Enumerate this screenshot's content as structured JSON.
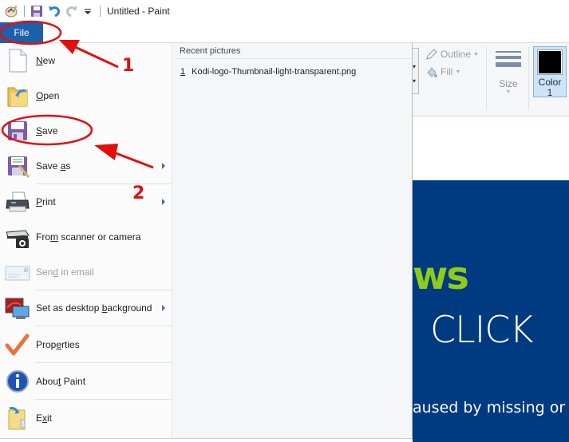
{
  "window": {
    "title": "Untitled - Paint"
  },
  "quick_access": {
    "icons": [
      "paint-app-icon",
      "save-icon",
      "undo-icon",
      "redo-icon",
      "customize-qa-icon"
    ]
  },
  "tabs": {
    "file_label": "File"
  },
  "file_menu": {
    "items": [
      {
        "label_pre": "",
        "label_ul": "N",
        "label_post": "ew",
        "icon": "new-file-icon",
        "has_submenu": false,
        "disabled": false
      },
      {
        "label_pre": "",
        "label_ul": "O",
        "label_post": "pen",
        "icon": "open-folder-icon",
        "has_submenu": false,
        "disabled": false
      },
      {
        "label_pre": "",
        "label_ul": "S",
        "label_post": "ave",
        "icon": "save-disk-icon",
        "has_submenu": false,
        "disabled": false
      },
      {
        "label_pre": "Save ",
        "label_ul": "a",
        "label_post": "s",
        "icon": "save-as-icon",
        "has_submenu": true,
        "disabled": false
      },
      {
        "label_pre": "",
        "label_ul": "P",
        "label_post": "rint",
        "icon": "printer-icon",
        "has_submenu": true,
        "disabled": false
      },
      {
        "label_pre": "Fro",
        "label_ul": "m",
        "label_post": " scanner or camera",
        "icon": "scanner-icon",
        "has_submenu": false,
        "disabled": false
      },
      {
        "label_pre": "Sen",
        "label_ul": "d",
        "label_post": " in email",
        "icon": "email-icon",
        "has_submenu": false,
        "disabled": true
      },
      {
        "label_pre": "Set as desktop ",
        "label_ul": "b",
        "label_post": "ackground",
        "icon": "desktop-background-icon",
        "has_submenu": true,
        "disabled": false
      },
      {
        "label_pre": "Prop",
        "label_ul": "e",
        "label_post": "rties",
        "icon": "properties-check-icon",
        "has_submenu": false,
        "disabled": false
      },
      {
        "label_pre": "Abou",
        "label_ul": "t",
        "label_post": " Paint",
        "icon": "info-icon",
        "has_submenu": false,
        "disabled": false
      },
      {
        "label_pre": "E",
        "label_ul": "x",
        "label_post": "it",
        "icon": "exit-icon",
        "has_submenu": false,
        "disabled": false
      }
    ],
    "recent": {
      "header": "Recent pictures",
      "items": [
        {
          "num": "1",
          "name": "Kodi-logo-Thumbnail-light-transparent.png"
        }
      ]
    }
  },
  "ribbon": {
    "outline_label": "Outline",
    "fill_label": "Fill",
    "size_label": "Size",
    "color1_label_line1": "Color",
    "color1_label_line2": "1",
    "color1_value": "#000000"
  },
  "canvas": {
    "green_text": "ws",
    "click_text": "CLICK",
    "line_text": "aused by missing or c",
    "bg_color": "#003a80",
    "green_color": "#8fcc1a"
  },
  "annotations": {
    "marker_1": "1",
    "marker_2": "2",
    "color": "#e01010"
  }
}
